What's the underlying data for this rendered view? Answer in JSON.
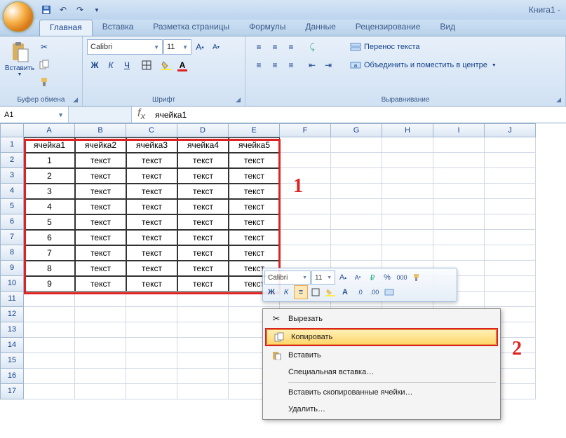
{
  "title": "Книга1 -",
  "tabs": [
    "Главная",
    "Вставка",
    "Разметка страницы",
    "Формулы",
    "Данные",
    "Рецензирование",
    "Вид"
  ],
  "active_tab": 0,
  "ribbon": {
    "clipboard": {
      "label": "Буфер обмена",
      "paste": "Вставить"
    },
    "font": {
      "label": "Шрифт",
      "name": "Calibri",
      "size": "11",
      "bold": "Ж",
      "italic": "К",
      "underline": "Ч"
    },
    "align": {
      "label": "Выравнивание",
      "wrap": "Перенос текста",
      "merge": "Объединить и поместить в центре"
    }
  },
  "namebox": "A1",
  "formula": "ячейка1",
  "columns": [
    "A",
    "B",
    "C",
    "D",
    "E",
    "F",
    "G",
    "H",
    "I",
    "J"
  ],
  "rows": [
    1,
    2,
    3,
    4,
    5,
    6,
    7,
    8,
    9,
    10,
    11,
    12,
    13,
    14,
    15,
    16,
    17
  ],
  "data": [
    [
      "ячейка1",
      "ячейка2",
      "ячейка3",
      "ячейка4",
      "ячейка5"
    ],
    [
      "1",
      "текст",
      "текст",
      "текст",
      "текст"
    ],
    [
      "2",
      "текст",
      "текст",
      "текст",
      "текст"
    ],
    [
      "3",
      "текст",
      "текст",
      "текст",
      "текст"
    ],
    [
      "4",
      "текст",
      "текст",
      "текст",
      "текст"
    ],
    [
      "5",
      "текст",
      "текст",
      "текст",
      "текст"
    ],
    [
      "6",
      "текст",
      "текст",
      "текст",
      "текст"
    ],
    [
      "7",
      "текст",
      "текст",
      "текст",
      "текст"
    ],
    [
      "8",
      "текст",
      "текст",
      "текст",
      "текст"
    ],
    [
      "9",
      "текст",
      "текст",
      "текст",
      "текст"
    ]
  ],
  "mini": {
    "font": "Calibri",
    "size": "11"
  },
  "ctx": {
    "cut": "Вырезать",
    "copy": "Копировать",
    "paste": "Вставить",
    "pspecial": "Специальная вставка…",
    "pinscopied": "Вставить скопированные ячейки…",
    "delete": "Удалить…"
  },
  "anno1": "1",
  "anno2": "2"
}
